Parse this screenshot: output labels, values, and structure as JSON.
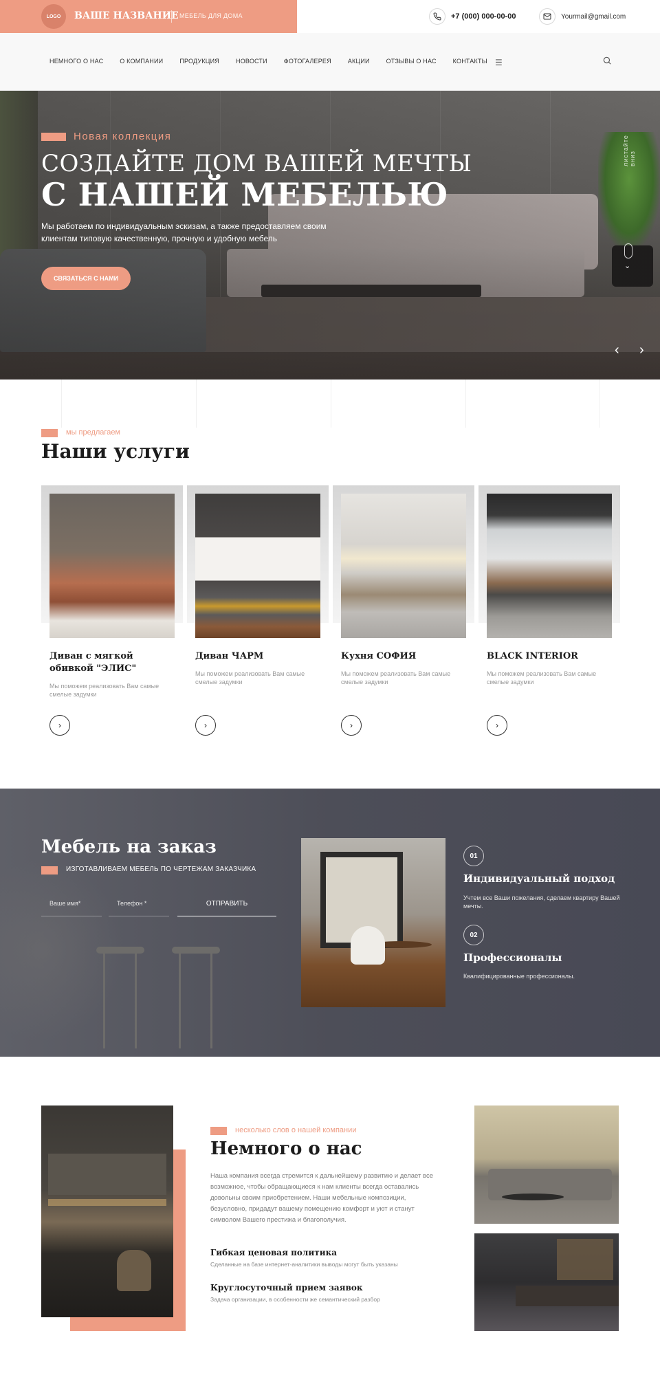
{
  "header": {
    "logo": "LOGO",
    "brand_name": "ВАШЕ НАЗВАНИЕ",
    "brand_tagline": "МЕБЕЛЬ ДЛЯ ДОМА",
    "phone": "+7 (000) 000-00-00",
    "email": "Yourmail@gmail.com",
    "accent_color": "#ee9c83"
  },
  "nav": {
    "items": [
      {
        "label": "НЕМНОГО О НАС"
      },
      {
        "label": "О КОМПАНИИ"
      },
      {
        "label": "ПРОДУКЦИЯ"
      },
      {
        "label": "НОВОСТИ"
      },
      {
        "label": "ФОТОГАЛЕРЕЯ"
      },
      {
        "label": "АКЦИИ"
      },
      {
        "label": "ОТЗЫВЫ О НАС"
      },
      {
        "label": "КОНТАКТЫ"
      }
    ],
    "menu_icon": "menu-icon",
    "search_icon": "search-icon"
  },
  "hero": {
    "kicker": "Новая коллекция",
    "title_line1": "СОЗДАЙТЕ ДОМ ВАШЕЙ МЕЧТЫ",
    "title_line2": "С НАШЕЙ МЕБЕЛЬЮ",
    "text": "Мы работаем по индивидуальным эскизам, а также предоставляем своим клиентам типовую качественную, прочную и удобную мебель",
    "button": "СВЯЗАТЬСЯ С НАМИ",
    "side_label": "листайте вниз"
  },
  "services": {
    "kicker": "мы предлагаем",
    "title": "Наши услуги",
    "cards": [
      {
        "title": "Диван с мягкой обивкой \"ЭЛИС\"",
        "text": "Мы поможем реализовать Вам самые смелые задумки"
      },
      {
        "title": "Диван ЧАРМ",
        "text": "Мы поможем реализовать Вам самые смелые задумки"
      },
      {
        "title": "Кухня СОФИЯ",
        "text": "Мы поможем реализовать Вам самые смелые задумки"
      },
      {
        "title": "BLACK INTERIOR",
        "text": "Мы поможем реализовать Вам самые смелые задумки"
      }
    ]
  },
  "custom": {
    "title": "Мебель на заказ",
    "subtitle": "ИЗГОТАВЛИВАЕМ МЕБЕЛЬ ПО ЧЕРТЕЖАМ ЗАКАЗЧИКА",
    "name_placeholder": "Ваше имя*",
    "phone_placeholder": "Телефон *",
    "submit": "ОТПРАВИТЬ",
    "features": [
      {
        "num": "01",
        "title": "Индивидуальный подход",
        "text": "Учтем все Ваши пожелания, сделаем квартиру Вашей мечты."
      },
      {
        "num": "02",
        "title": "Профессионалы",
        "text": "Квалифицированные профессионалы."
      }
    ]
  },
  "about": {
    "kicker": "несколько слов о нашей компании",
    "title": "Немного о нас",
    "text": "Наша компания всегда стремится к дальнейшему развитию и делает все возможное, чтобы обращающиеся к нам клиенты всегда оставались довольны своим приобретением. Наши мебельные композиции, безусловно, придадут вашему помещению комфорт и уют и станут символом Вашего престижа и благополучия.",
    "features": [
      {
        "title": "Гибкая ценовая политика",
        "text": "Сделанные на базе интернет-аналитики выводы могут быть указаны"
      },
      {
        "title": "Круглосуточный прием заявок",
        "text": "Задача организации, в особенности же семантический разбор"
      }
    ]
  }
}
